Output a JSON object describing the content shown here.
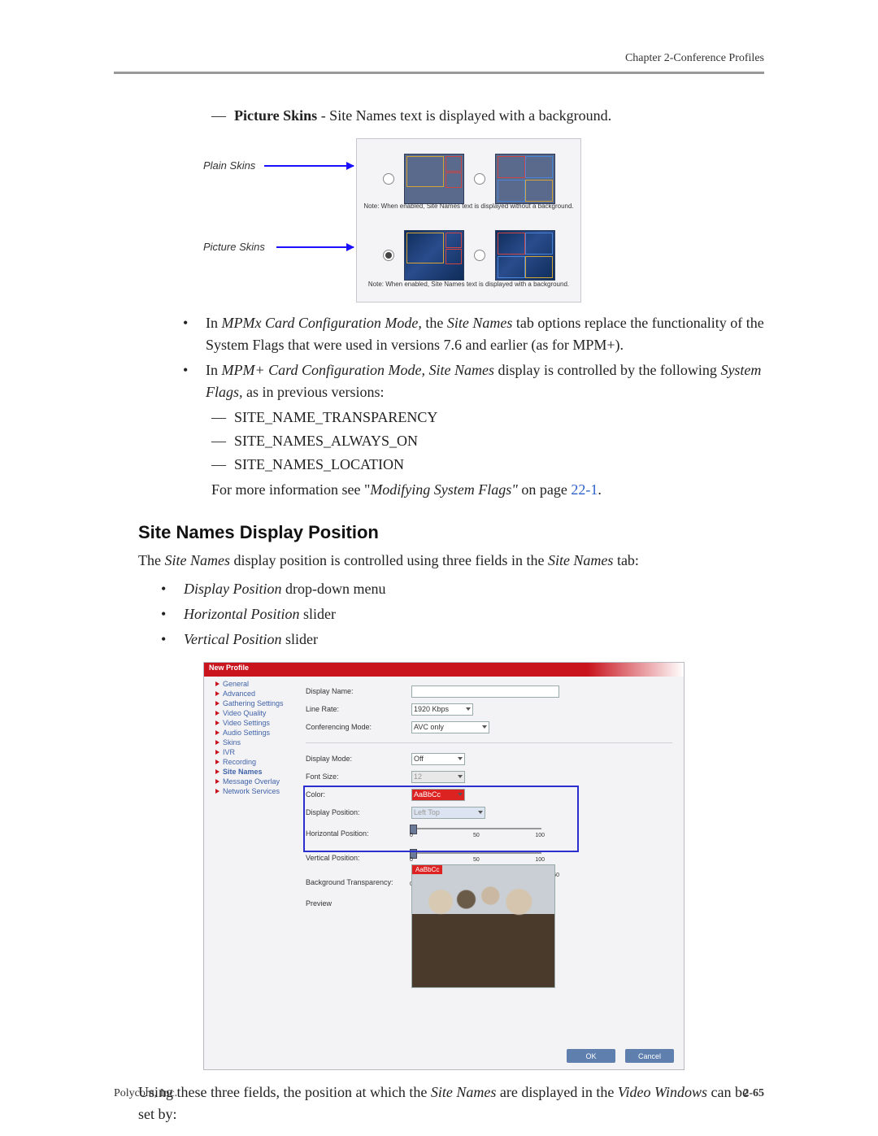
{
  "header": {
    "chapter": "Chapter 2-Conference Profiles"
  },
  "intro": {
    "picture_skins_lead": "Picture Skins",
    "picture_skins_rest": " - Site Names text is displayed with a background."
  },
  "skins": {
    "label_plain": "Plain Skins",
    "label_picture": "Picture Skins",
    "note_plain": "Note: When enabled, Site Names text is displayed without a background.",
    "note_picture": "Note: When enabled, Site Names text is displayed with a background."
  },
  "bullets": {
    "b1_pre": "In ",
    "b1_i1": "MPMx Card Configuration Mode,",
    "b1_mid": " the ",
    "b1_i2": "Site Names",
    "b1_post": " tab options replace the functionality of the System Flags that were used in versions 7.6 and earlier (as for MPM+).",
    "b2_pre": "In ",
    "b2_i1": "MPM+ Card Configuration Mode, Site Names",
    "b2_mid": " display is controlled by the following ",
    "b2_i2": "System Flags,",
    "b2_post": " as in previous versions:",
    "flags": [
      "SITE_NAME_TRANSPARENCY",
      "SITE_NAMES_ALWAYS_ON",
      "SITE_NAMES_LOCATION"
    ],
    "more_pre": "For more information see  \"",
    "more_it": "Modifying System Flags\"",
    "more_post": " on page ",
    "more_link": "22-1",
    "more_dot": "."
  },
  "section": {
    "title": "Site Names Display Position",
    "p1_pre": "The ",
    "p1_i1": "Site Names",
    "p1_mid": " display position is controlled using three fields in the ",
    "p1_i2": "Site Names",
    "p1_post": " tab:",
    "items": [
      {
        "it": "Display Position",
        "rest": " drop-down menu"
      },
      {
        "it": "Horizontal Position",
        "rest": " slider"
      },
      {
        "it": "Vertical Position",
        "rest": " slider"
      }
    ],
    "p2_pre": "Using these three fields, the position at which the ",
    "p2_i1": "Site Names",
    "p2_mid": " are displayed in the ",
    "p2_i2": "Video Windows",
    "p2_post": " can be set by:"
  },
  "dialog": {
    "title": "New Profile",
    "sidebar": [
      "General",
      "Advanced",
      "Gathering Settings",
      "Video Quality",
      "Video Settings",
      "Audio Settings",
      "Skins",
      "IVR",
      "Recording",
      "Site Names",
      "Message Overlay",
      "Network Services"
    ],
    "active_index": 9,
    "form": {
      "display_name_lbl": "Display Name:",
      "display_name_val": "",
      "line_rate_lbl": "Line Rate:",
      "line_rate_val": "1920 Kbps",
      "conf_mode_lbl": "Conferencing Mode:",
      "conf_mode_val": "AVC only",
      "disp_mode_lbl": "Display Mode:",
      "disp_mode_val": "Off",
      "font_size_lbl": "Font Size:",
      "font_size_val": "12",
      "color_lbl": "Color:",
      "color_val": "AaBbCc",
      "disp_pos_lbl": "Display Position:",
      "disp_pos_val": "Left Top",
      "hpos_lbl": "Horizontal Position:",
      "vpos_lbl": "Vertical Position:",
      "bgtrans_lbl": "Background Transparency:",
      "preview_lbl": "Preview",
      "preview_tag": "AaBbCc",
      "slider_0": "0",
      "slider_50": "50",
      "slider_100": "100",
      "bg_50": "50"
    },
    "buttons": {
      "ok": "OK",
      "cancel": "Cancel"
    }
  },
  "footer": {
    "left": "Polycom, Inc.",
    "right": "2-65"
  }
}
